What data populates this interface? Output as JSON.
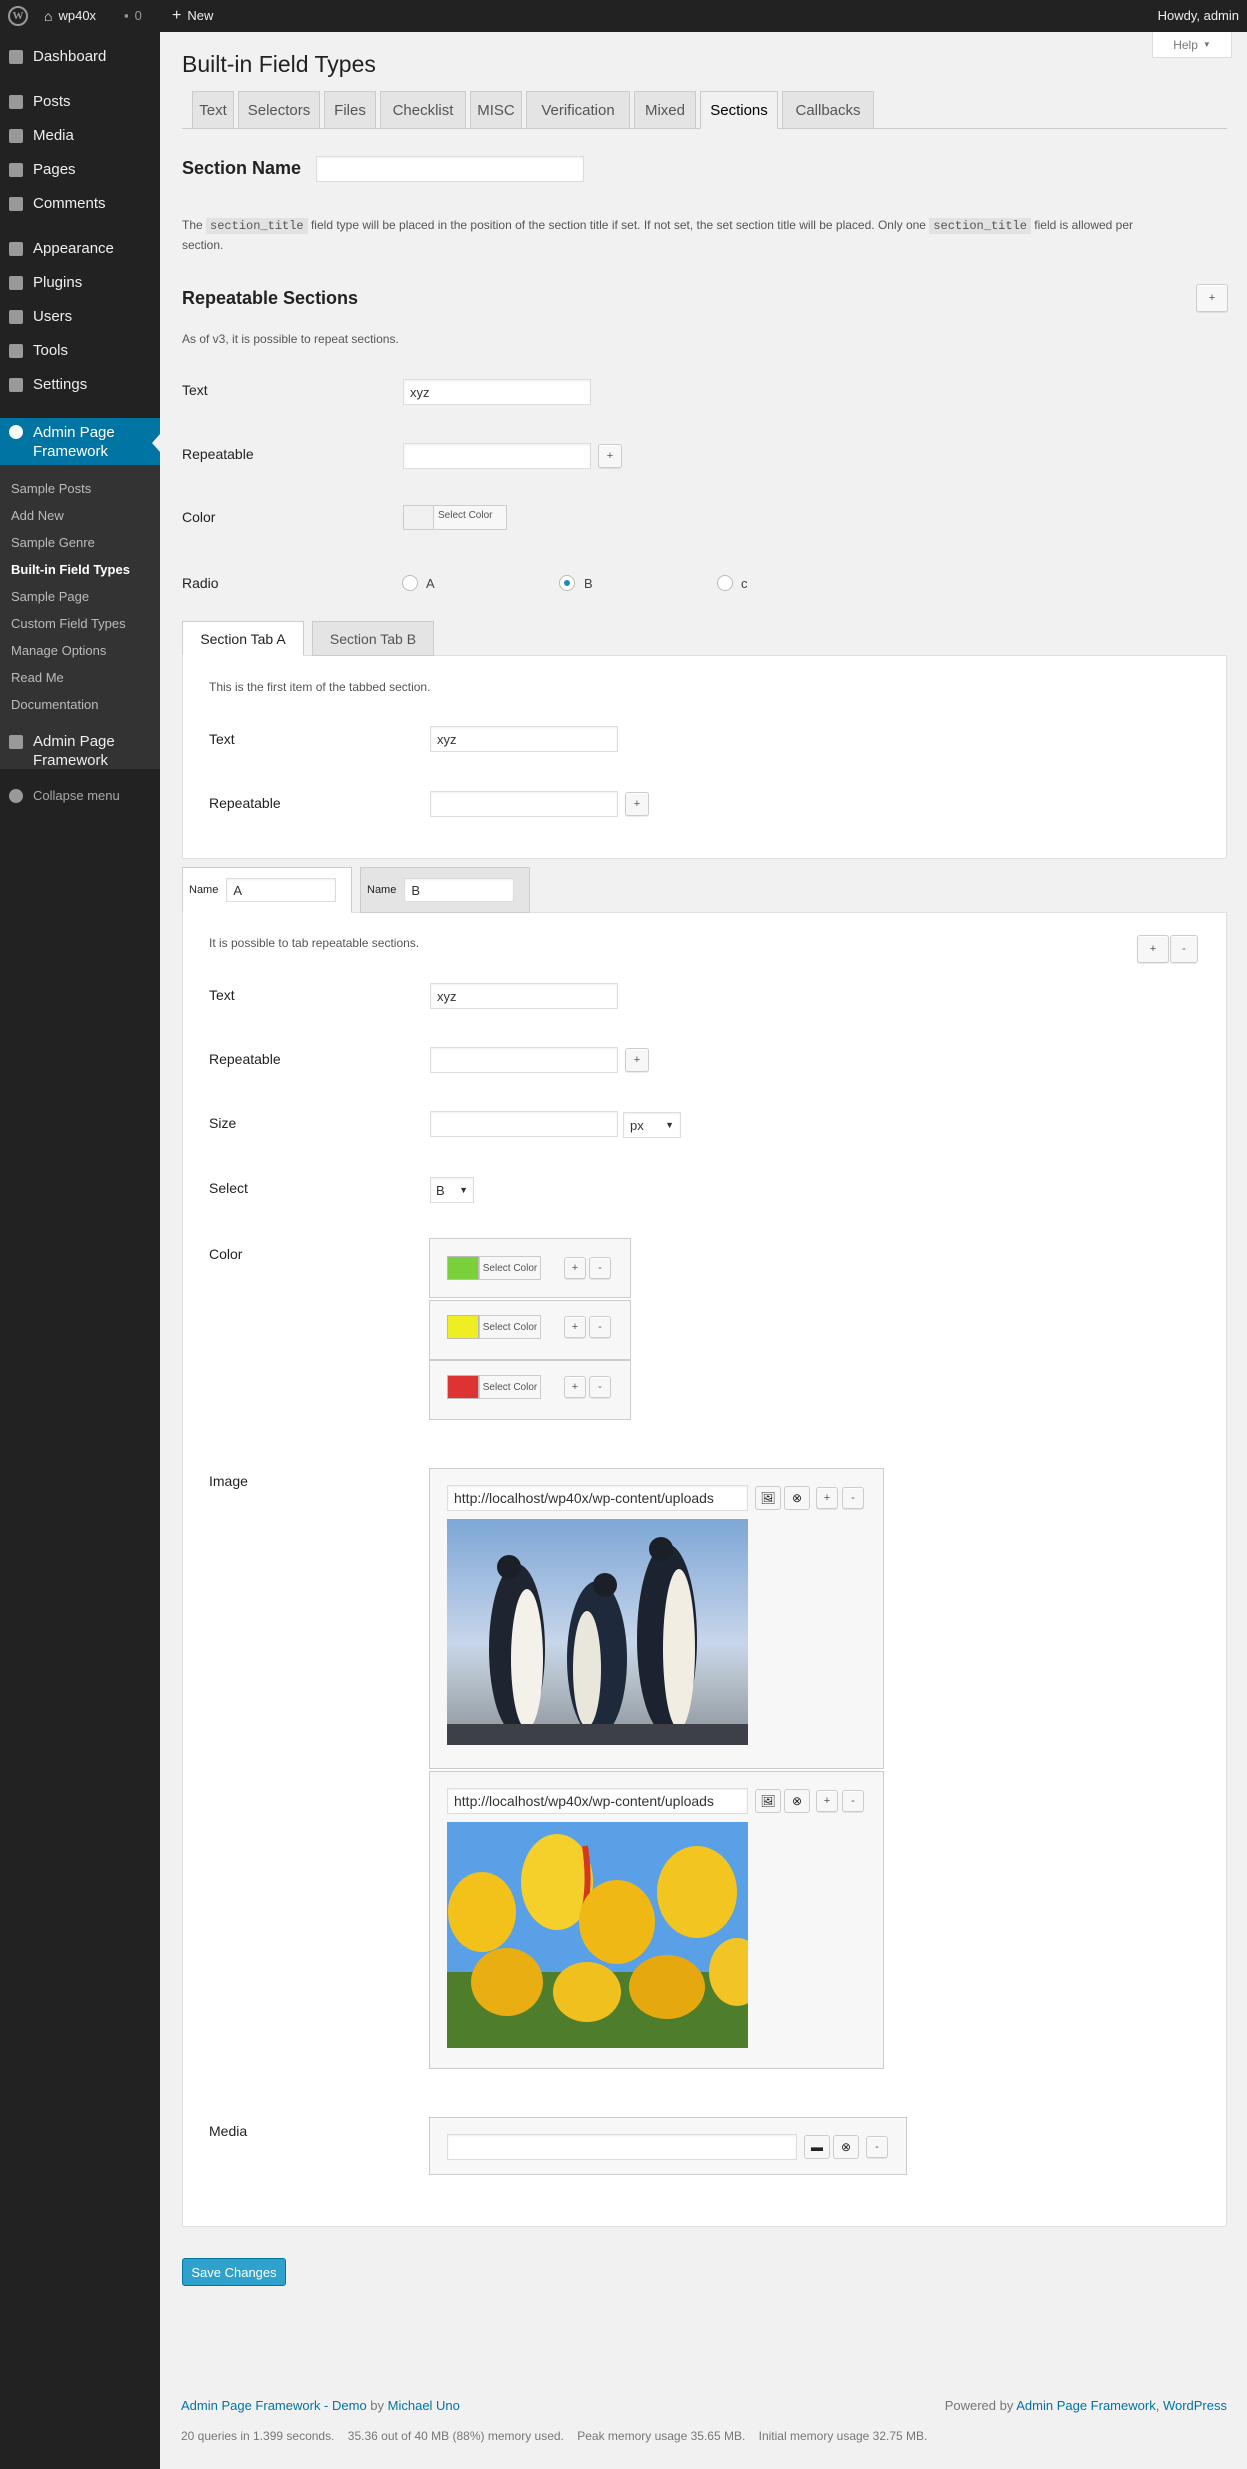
{
  "adminbar": {
    "site_name": "wp40x",
    "comments_count": "0",
    "new_label": "New",
    "howdy": "Howdy, admin"
  },
  "sidebar": {
    "items": [
      {
        "label": "Dashboard"
      },
      {
        "label": "Posts"
      },
      {
        "label": "Media"
      },
      {
        "label": "Pages"
      },
      {
        "label": "Comments"
      },
      {
        "label": "Appearance"
      },
      {
        "label": "Plugins"
      },
      {
        "label": "Users"
      },
      {
        "label": "Tools"
      },
      {
        "label": "Settings"
      }
    ],
    "current": {
      "label_line1": "Admin Page",
      "label_line2": "Framework"
    },
    "submenu": [
      "Sample Posts",
      "Add New",
      "Sample Genre",
      "Built-in Field Types",
      "Sample Page",
      "Custom Field Types",
      "Manage Options",
      "Read Me",
      "Documentation"
    ],
    "second": {
      "label_line1": "Admin Page",
      "label_line2": "Framework"
    },
    "collapse": "Collapse menu"
  },
  "page": {
    "title": "Built-in Field Types",
    "help": "Help"
  },
  "tabs": [
    "Text",
    "Selectors",
    "Files",
    "Checklist",
    "MISC",
    "Verification",
    "Mixed",
    "Sections",
    "Callbacks"
  ],
  "section_name": {
    "label": "Section Name",
    "value": ""
  },
  "section_note": {
    "pre": "The ",
    "code1": "section_title",
    "mid": " field type will be placed in the position of the section title if set. If not set, the set section title will be placed. Only one ",
    "code2": "section_title",
    "post": " field is allowed per",
    "line2": "section."
  },
  "repeatable": {
    "title": "Repeatable Sections",
    "add": "+",
    "desc": "As of v3, it is possible to repeat sections.",
    "text_label": "Text",
    "text_value": "xyz",
    "rep_label": "Repeatable",
    "rep_value": "",
    "rep_btn": "+",
    "color_label": "Color",
    "select_color": "Select Color",
    "radio_label": "Radio",
    "radio": [
      "A",
      "B",
      "c"
    ]
  },
  "section_tabs": {
    "tab_a": "Section Tab A",
    "tab_b": "Section Tab B",
    "desc": "This is the first item of the tabbed section.",
    "text_label": "Text",
    "text_value": "xyz",
    "rep_label": "Repeatable",
    "rep_btn": "+"
  },
  "repeat_tabs": {
    "name_label": "Name",
    "name_a": "A",
    "name_b": "B",
    "desc": "It is possible to tab repeatable sections.",
    "add": "+",
    "remove": "-",
    "text_label": "Text",
    "text_value": "xyz",
    "rep_label": "Repeatable",
    "rep_btn": "+",
    "size_label": "Size",
    "size_unit": "px",
    "select_label": "Select",
    "select_value": "B",
    "color_label": "Color",
    "select_color": "Select Color",
    "colors": [
      "#7ad03a",
      "#eeee22",
      "#dd3333"
    ],
    "image_label": "Image",
    "image_url": "http://localhost/wp40x/wp-content/uploads",
    "media_label": "Media",
    "media_value": ""
  },
  "save": "Save Changes",
  "footer": {
    "left_link": "Admin Page Framework - Demo",
    "by": " by ",
    "author": "Michael Uno",
    "right_pre": "Powered by ",
    "right_link1": "Admin Page Framework",
    "comma": ", ",
    "right_link2": "WordPress",
    "stats": "20 queries in 1.399 seconds.    35.36 out of 40 MB (88%) memory used.    Peak memory usage 35.65 MB.    Initial memory usage 32.75 MB."
  }
}
